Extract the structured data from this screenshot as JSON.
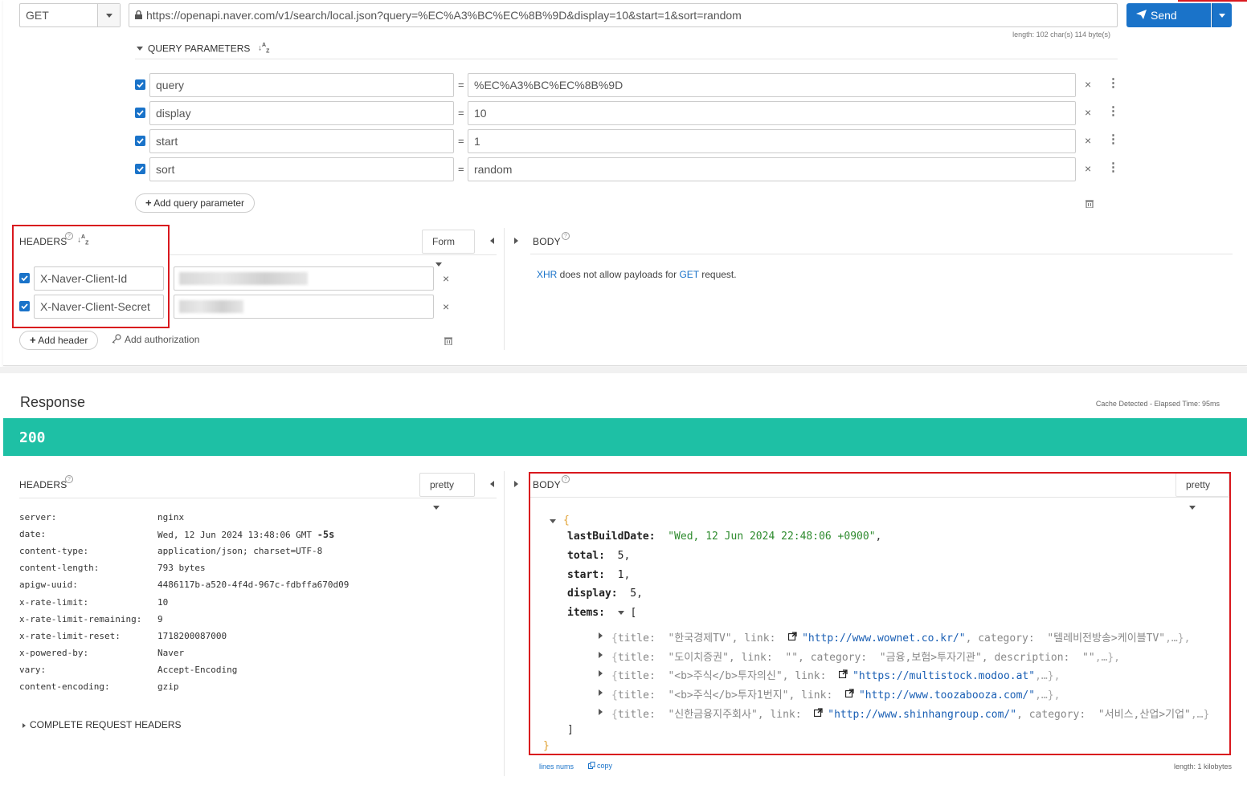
{
  "request": {
    "method": "GET",
    "url": "https://openapi.naver.com/v1/search/local.json?query=%EC%A3%BC%EC%8B%9D&display=10&start=1&sort=random",
    "length_info": "length: 102 char(s) 114 byte(s)",
    "send_label": "Send"
  },
  "query": {
    "section_label": "QUERY PARAMETERS",
    "params": [
      {
        "name": "query",
        "value": "%EC%A3%BC%EC%8B%9D"
      },
      {
        "name": "display",
        "value": "10"
      },
      {
        "name": "start",
        "value": "1"
      },
      {
        "name": "sort",
        "value": "random"
      }
    ],
    "add_label": "Add query parameter"
  },
  "req_headers": {
    "section_label": "HEADERS",
    "form_label": "Form",
    "items": [
      {
        "name": "X-Naver-Client-Id"
      },
      {
        "name": "X-Naver-Client-Secret"
      }
    ],
    "add_header_label": "Add header",
    "add_auth_label": "Add authorization"
  },
  "req_body": {
    "section_label": "BODY",
    "xhr": "XHR",
    "msg_mid": " does not allow payloads for ",
    "get": "GET",
    "msg_end": " request."
  },
  "response": {
    "title": "Response",
    "cache_info": "Cache Detected - Elapsed Time: 95ms",
    "status": "200",
    "headers_label": "HEADERS",
    "pretty_label": "pretty",
    "headers": [
      {
        "k": "server:",
        "v": "nginx"
      },
      {
        "k": "date:",
        "v": "Wed, 12 Jun 2024 13:48:06 GMT",
        "extra": "-5s"
      },
      {
        "k": "content-type:",
        "v": "application/json; charset=UTF-8"
      },
      {
        "k": "content-length:",
        "v": "793 bytes"
      },
      {
        "k": "apigw-uuid:",
        "v": "4486117b-a520-4f4d-967c-fdbffa670d09"
      },
      {
        "k": "x-rate-limit:",
        "v": "10"
      },
      {
        "k": "x-rate-limit-remaining:",
        "v": "9"
      },
      {
        "k": "x-rate-limit-reset:",
        "v": "1718200087000"
      },
      {
        "k": "x-powered-by:",
        "v": "Naver"
      },
      {
        "k": "vary:",
        "v": "Accept-Encoding"
      },
      {
        "k": "content-encoding:",
        "v": "gzip"
      }
    ],
    "complete_headers_label": "COMPLETE REQUEST HEADERS",
    "body_label": "BODY",
    "body_pretty_label": "pretty",
    "json": {
      "lastBuildDate": "\"Wed, 12 Jun 2024 22:48:06 +0900\"",
      "total": "5",
      "start": "1",
      "display": "5",
      "items": [
        {
          "title": "\"한국경제TV\"",
          "link": "\"http://www.wownet.co.kr/\"",
          "rest_key": "category:",
          "rest_val": "\"텔레비전방송>케이블TV\"",
          "tail": ",…},"
        },
        {
          "title": "\"도이치증권\"",
          "link": "\"\"",
          "rest_key": "category:",
          "rest_val": "\"금융,보험>투자기관\"",
          "rest2_key": "description:",
          "rest2_val": "\"\"",
          "tail": ",…},"
        },
        {
          "title": "\"<b>주식</b>투자의신\"",
          "link": "\"https://multistock.modoo.at\"",
          "tail": ",…},"
        },
        {
          "title": "\"<b>주식</b>투자1번지\"",
          "link": "\"http://www.toozabooza.com/\"",
          "tail": ",…},"
        },
        {
          "title": "\"신한금융지주회사\"",
          "link": "\"http://www.shinhangroup.com/\"",
          "rest_key": "category:",
          "rest_val": "\"서비스,산업>기업\"",
          "tail": ",…}"
        }
      ]
    },
    "lines_nums_label": "lines nums",
    "copy_label": "copy",
    "length_info": "length: 1 kilobytes"
  }
}
